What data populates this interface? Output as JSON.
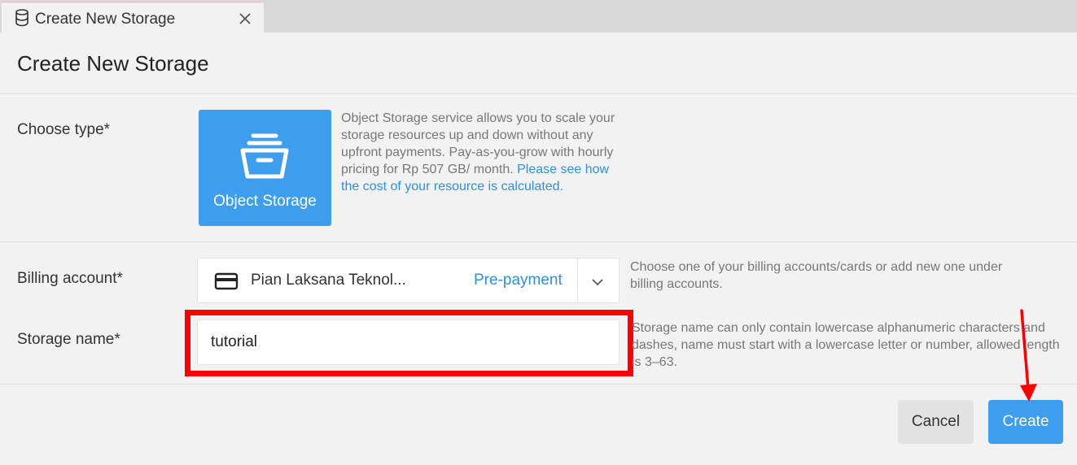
{
  "tab": {
    "title": "Create New Storage",
    "icon": "database-icon",
    "close_icon": "close-icon"
  },
  "page": {
    "title": "Create New Storage"
  },
  "type_section": {
    "label": "Choose type*",
    "option": {
      "label": "Object Storage",
      "icon": "storage-box-icon",
      "selected": true
    },
    "description": "Object Storage service allows you to scale your storage resources up and down without any upfront payments. Pay-as-you-grow with hourly pricing for Rp 507 GB/ month.",
    "link_text": "Please see how the cost of your resource is calculated."
  },
  "billing": {
    "label": "Billing account*",
    "card_icon": "credit-card-icon",
    "account_name": "Pian Laksana Teknol...",
    "payment_type": "Pre-payment",
    "help": "Choose one of your billing accounts/cards or add new one under billing accounts."
  },
  "storage_name": {
    "label": "Storage name*",
    "value": "tutorial",
    "help": "Storage name can only contain lowercase alphanumeric characters and dashes, name must start with a lowercase letter or number, allowed length is 3–63."
  },
  "actions": {
    "cancel_label": "Cancel",
    "create_label": "Create"
  },
  "colors": {
    "accent": "#3d9ef0",
    "link": "#2e8fe6",
    "annotation": "#ff0000",
    "background": "#f2f2f2"
  }
}
